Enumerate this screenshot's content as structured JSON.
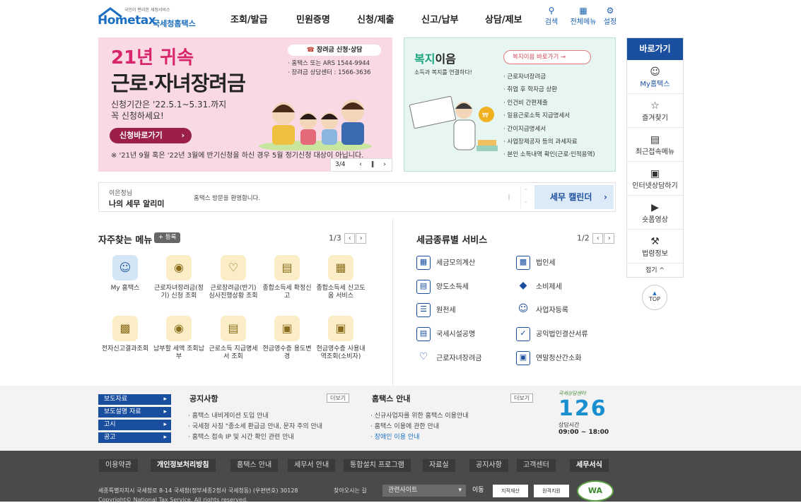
{
  "header": {
    "logo_small": "국민이 편리한 세정서비스",
    "logo_main": "Hometax",
    "logo_sub": "국세청홈택스",
    "nav": [
      "조회/발급",
      "민원증명",
      "신청/제출",
      "신고/납부",
      "상담/제보"
    ],
    "util": [
      {
        "label": "검색",
        "icon": "search-icon"
      },
      {
        "label": "전체메뉴",
        "icon": "grid-icon"
      },
      {
        "label": "설정",
        "icon": "gear-icon"
      }
    ]
  },
  "banner1": {
    "title1": "21년 귀속",
    "title2": "근로·자녀장려금",
    "badge": "장려금 신청·상담",
    "info1": "· 홈택스 또는 ARS 1544-9944",
    "info2": "· 장려금 상담센터 : 1566-3636",
    "period": "신청기간은 '22.5.1~5.31.까지",
    "period2": "꼭 신청하세요!",
    "button": "신청바로가기",
    "note": "※ '21년 9월 혹은 '22년 3월에 반기신청을 하신 경우 5월 정기신청 대상이 아닙니다.",
    "page": "3/4"
  },
  "banner2": {
    "title_a": "복지",
    "title_b": "이음",
    "subtitle": "소득과 복지를 연결하다!",
    "button": "복지이음 바로가기",
    "items": [
      "근로자녀장려금",
      "취업 후 학자금 상환",
      "인건비 간편제출",
      "일용근로소득 지급명세서",
      "간이지급명세서",
      "사업장제공자 등의 과세자료",
      "본인 소득내역 확인(근로·인적용역)"
    ]
  },
  "quick": {
    "title": "바로가기",
    "items": [
      {
        "label": "My홈택스",
        "icon": "person-icon"
      },
      {
        "label": "즐겨찾기",
        "icon": "star-icon"
      },
      {
        "label": "최근접속메뉴",
        "icon": "recent-icon"
      },
      {
        "label": "인터넷상담하기",
        "icon": "monitor-icon"
      },
      {
        "label": "숏폼영상",
        "icon": "play-icon"
      },
      {
        "label": "법령정보",
        "icon": "gavel-icon"
      }
    ],
    "fold": "접기 ^",
    "top": "TOP"
  },
  "noticebar": {
    "name": "이은정님",
    "title": "나의 세무 알리미",
    "message": "홈택스 방문을 환영합니다.",
    "calendar": "세무 캘린더"
  },
  "freq": {
    "title": "자주찾는 메뉴",
    "reg": "+ 등록",
    "page": "1/3",
    "items": [
      "My 홈택스",
      "근로자녀장려금(정기) 신청 조회",
      "근로장려금(반기) 심사진행상황 조회",
      "종합소득세 확정신고",
      "종합소득세 신고도움 서비스",
      "전자신고결과조회",
      "납부할 세액 조회납부",
      "근로소득 지급명세서 조회",
      "현금영수증 용도변경",
      "현금영수증 사용내역조회(소비자)"
    ]
  },
  "taxsvc": {
    "title": "세금종류별 서비스",
    "page": "1/2",
    "items": [
      "세금모의계산",
      "법인세",
      "양도소득세",
      "소비제세",
      "원천세",
      "사업자등록",
      "국세시설공명",
      "공익법인결산서류",
      "근로자녀장려금",
      "연말정산간소화"
    ]
  },
  "lower": {
    "tags": [
      "보도자료",
      "보도설명 자료",
      "고시",
      "공고"
    ],
    "notice_title": "공지사항",
    "notice_items": [
      "· 홈택스 내비게이션 도입 안내",
      "· 국세청 사칭 \"종소세 환급금 안내, 문자 주의 안내",
      "· 홈택스 접속 IP 및 시간 확인 관련 안내"
    ],
    "guide_title": "홈택스 안내",
    "guide_items": [
      "· 신규사업자를 위한 홈택스 이용안내",
      "· 홈택스 이용에 관한 안내",
      "· 장애인 이용 안내"
    ],
    "more": "더보기",
    "center_label": "국세상담센터",
    "center_number": "126",
    "hours_label": "상담시간",
    "hours": "09:00 ~ 18:00"
  },
  "footer": {
    "menu": [
      "이용약관",
      "개인정보처리방침",
      "홈택스 안내",
      "세무서 안내",
      "통합설치 프로그램",
      "자료실",
      "공지사항",
      "고객센터",
      "세무서식"
    ],
    "address": "세종특별자치시 국세청로 8-14 국세청(정부세종2청사 국세청동) (우편번호) 30128",
    "find": "찾아오시는 길",
    "select": "관련사이트",
    "go": "이동",
    "copyright": "Copyright© National Tax Service. All rights reserved.",
    "badge1": "지적재산",
    "badge2": "원격지원",
    "badge3": "WA"
  }
}
